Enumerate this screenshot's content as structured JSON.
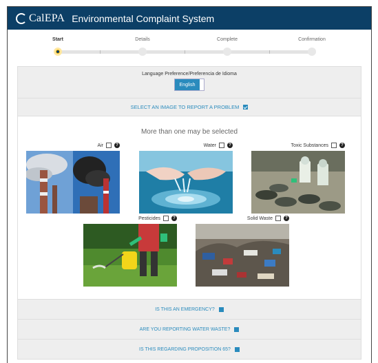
{
  "header": {
    "logo_text": "CalEPA",
    "app_title": "Environmental Complaint System"
  },
  "steps": [
    {
      "label": "Start",
      "active": true
    },
    {
      "label": "Details",
      "active": false
    },
    {
      "label": "Complete",
      "active": false
    },
    {
      "label": "Confirmation",
      "active": false
    }
  ],
  "language": {
    "label": "Language Preference/Preferencia de Idioma",
    "selected": "English"
  },
  "select_image": {
    "label": "SELECT AN IMAGE TO REPORT A PROBLEM"
  },
  "images": {
    "hint": "More than one may be selected",
    "categories": [
      {
        "label": "Air"
      },
      {
        "label": "Water"
      },
      {
        "label": "Toxic Substances"
      },
      {
        "label": "Pesticides"
      },
      {
        "label": "Solid Waste"
      }
    ]
  },
  "sections": [
    {
      "label": "IS THIS AN EMERGENCY?"
    },
    {
      "label": "ARE YOU REPORTING WATER WASTE?"
    },
    {
      "label": "IS THIS REGARDING PROPOSITION 65?"
    }
  ],
  "colors": {
    "header_bg": "#0c3f66",
    "accent": "#2a8bbd",
    "active_step": "#f7b500"
  }
}
